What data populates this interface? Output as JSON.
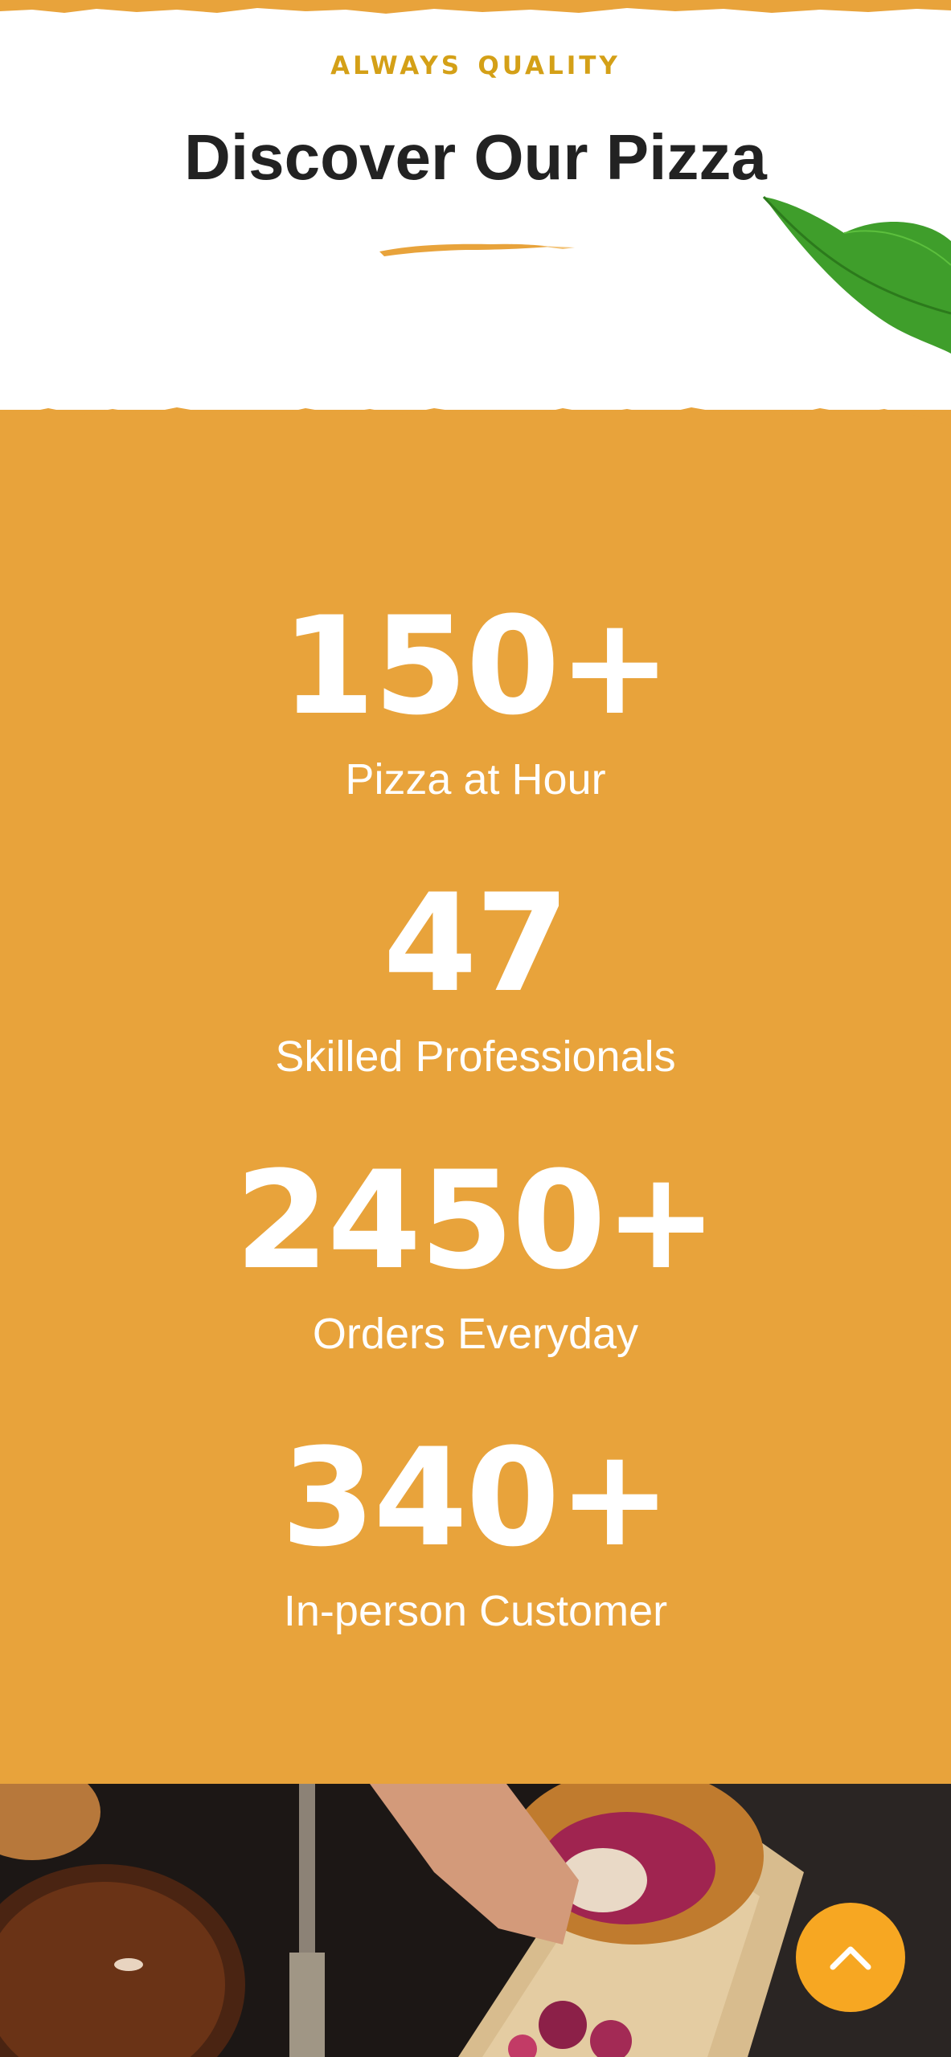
{
  "header": {
    "eyebrow": "always quality",
    "title": "Discover Our Pizza"
  },
  "stats": [
    {
      "value": "150+",
      "label": "Pizza at Hour"
    },
    {
      "value": "47",
      "label": "Skilled Professionals"
    },
    {
      "value": "2450+",
      "label": "Orders Everyday"
    },
    {
      "value": "340+",
      "label": "In-person Customer"
    }
  ],
  "colors": {
    "accent": "#E8A33B",
    "eyebrow": "#D4A017",
    "title": "#222222",
    "scroll_button": "#F7A722"
  },
  "icons": {
    "scroll_top": "chevron-up-icon"
  }
}
